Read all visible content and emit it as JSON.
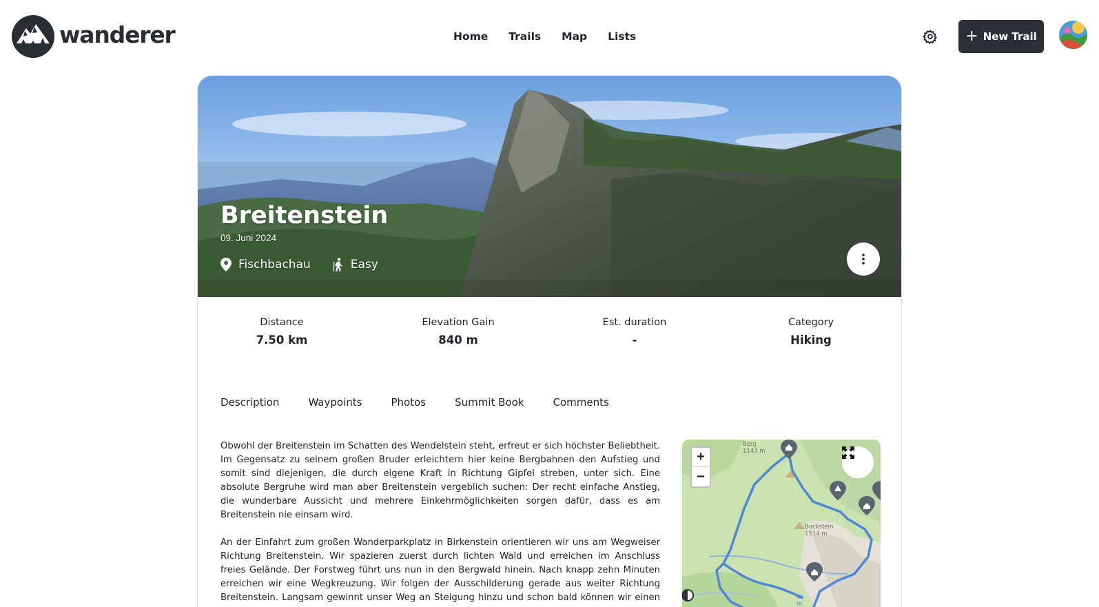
{
  "app": {
    "name": "wanderer"
  },
  "nav": {
    "items": [
      "Home",
      "Trails",
      "Map",
      "Lists"
    ]
  },
  "header": {
    "new_trail_label": "New Trail",
    "settings_icon": "gear-icon",
    "new_trail_icon": "plus-icon"
  },
  "trail": {
    "title": "Breitenstein",
    "date": "09. Juni 2024",
    "location": "Fischbachau",
    "difficulty": "Easy",
    "location_icon": "map-pin-icon",
    "difficulty_icon": "hiker-icon"
  },
  "stats": [
    {
      "label": "Distance",
      "value": "7.50 km"
    },
    {
      "label": "Elevation Gain",
      "value": "840 m"
    },
    {
      "label": "Est. duration",
      "value": "-"
    },
    {
      "label": "Category",
      "value": "Hiking"
    }
  ],
  "tabs": [
    "Description",
    "Waypoints",
    "Photos",
    "Summit Book",
    "Comments"
  ],
  "description": {
    "paragraphs": [
      "Obwohl der Breitenstein im Schatten des Wendelstein steht, erfreut er sich höchster Beliebtheit. Im Gegensatz zu seinem großen Bruder erleichtern hier keine Bergbahnen den Aufstieg und somit sind diejenigen, die durch eigene Kraft in Richtung Gipfel streben, unter sich. Eine absolute Bergruhe wird man aber Breitenstein vergeblich suchen: Der recht einfache Anstieg, die wunderbare Aussicht und mehrere Einkehrmöglichkeiten sorgen dafür, dass es am Breitenstein nie einsam wird.",
      "An der Einfahrt zum großen Wanderparkplatz in Birkenstein orientieren wir uns am Wegweiser Richtung Breitenstein. Wir spazieren zuerst durch lichten Wald und erreichen im Anschluss freies Gelände. Der Forstweg führt uns nun in den Bergwald hinein. Nach knapp zehn Minuten erreichen wir eine Wegkreuzung. Wir folgen der Ausschilderung gerade aus weiter Richtung Breitenstein. Langsam gewinnt unser Weg an Steigung hinzu und schon bald können wir einen ersten Blick auf die südlichen Nachbargipfel wie den Hochmiesing und die Aiplspitz werfen."
    ]
  },
  "map": {
    "zoom_in": "+",
    "zoom_out": "−",
    "labels": [
      {
        "name": "Berg",
        "sub": "1143 m"
      },
      {
        "name": "Bockstein",
        "sub": "1514 m"
      },
      {
        "name": "Ke",
        "sub": "m"
      }
    ],
    "route_color": "#4f86d6",
    "fullscreen_icon": "fullscreen-icon"
  },
  "colors": {
    "primary_button": "#2b2f36",
    "text": "#1f2328",
    "card_border": "#e3e5e8"
  }
}
